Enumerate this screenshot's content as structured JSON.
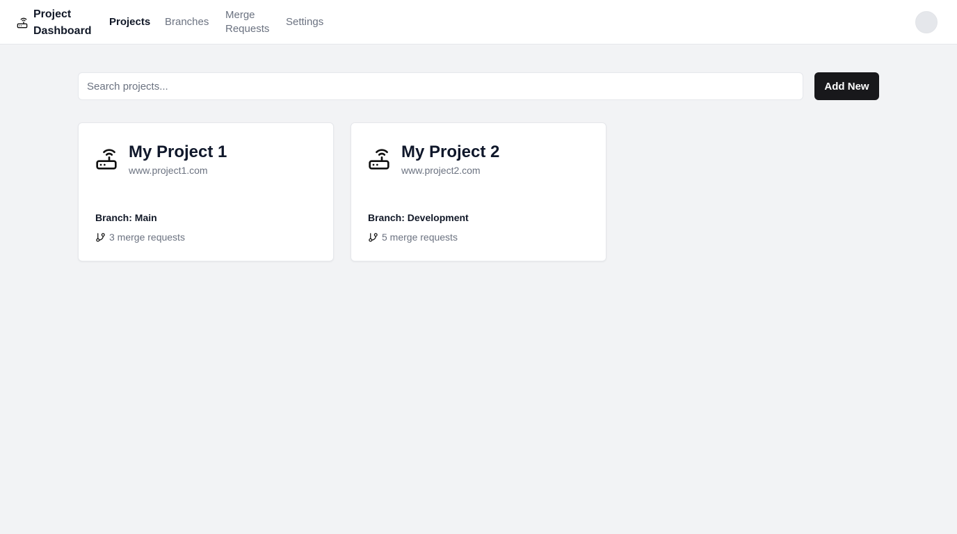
{
  "header": {
    "brand": "Project Dashboard",
    "brand_icon": "router-icon",
    "nav": [
      {
        "label": "Projects",
        "active": true
      },
      {
        "label": "Branches",
        "active": false
      },
      {
        "label": "Merge Requests",
        "active": false
      },
      {
        "label": "Settings",
        "active": false
      }
    ]
  },
  "toolbar": {
    "search_placeholder": "Search projects...",
    "search_value": "",
    "add_label": "Add New"
  },
  "projects": [
    {
      "name": "My Project 1",
      "url": "www.project1.com",
      "branch": "Branch: Main",
      "merge_requests": "3 merge requests",
      "icon": "router-icon"
    },
    {
      "name": "My Project 2",
      "url": "www.project2.com",
      "branch": "Branch: Development",
      "merge_requests": "5 merge requests",
      "icon": "router-icon"
    }
  ],
  "colors": {
    "background": "#f2f3f5",
    "primary_button": "#18181b",
    "muted_text": "#6b7280"
  }
}
